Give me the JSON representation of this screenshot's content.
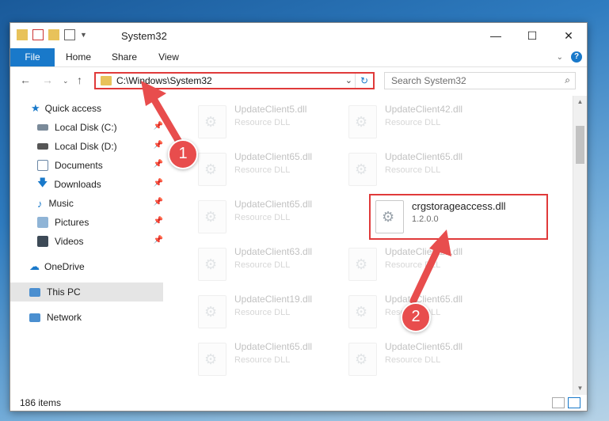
{
  "window": {
    "title": "System32"
  },
  "ribbon": {
    "tabs": [
      "File",
      "Home",
      "Share",
      "View"
    ],
    "help": "?"
  },
  "address": {
    "path": "C:\\Windows\\System32"
  },
  "search": {
    "placeholder": "Search System32"
  },
  "sidebar": {
    "items": [
      {
        "label": "Quick access",
        "icon": "star-icon"
      },
      {
        "label": "Local Disk (C:)",
        "icon": "drive-icon"
      },
      {
        "label": "Local Disk (D:)",
        "icon": "drive-icon"
      },
      {
        "label": "Documents",
        "icon": "documents-icon"
      },
      {
        "label": "Downloads",
        "icon": "download-icon"
      },
      {
        "label": "Music",
        "icon": "music-icon"
      },
      {
        "label": "Pictures",
        "icon": "pictures-icon"
      },
      {
        "label": "Videos",
        "icon": "videos-icon"
      },
      {
        "label": "OneDrive",
        "icon": "cloud-icon"
      },
      {
        "label": "This PC",
        "icon": "computer-icon"
      },
      {
        "label": "Network",
        "icon": "network-icon"
      }
    ]
  },
  "files": [
    {
      "name": "UpdateClient5.dll",
      "type": "Resource DLL"
    },
    {
      "name": "UpdateClient42.dll",
      "type": "Resource DLL"
    },
    {
      "name": "UpdateClient65.dll",
      "type": "Resource DLL"
    },
    {
      "name": "UpdateClient65.dll",
      "type": "Resource DLL"
    },
    {
      "name": "UpdateClient65.dll",
      "type": "Resource DLL"
    },
    {
      "name": "crgstorageaccess.dll",
      "type": "1.2.0.0"
    },
    {
      "name": "UpdateClient63.dll",
      "type": "Resource DLL"
    },
    {
      "name": "UpdateClient21.dll",
      "type": "Resource DLL"
    },
    {
      "name": "UpdateClient19.dll",
      "type": "Resource DLL"
    },
    {
      "name": "UpdateClient65.dll",
      "type": "Resource DLL"
    },
    {
      "name": "UpdateClient65.dll",
      "type": "Resource DLL"
    },
    {
      "name": "UpdateClient65.dll",
      "type": "Resource DLL"
    }
  ],
  "status": {
    "count": "186 items"
  },
  "annotations": {
    "step1": "1",
    "step2": "2"
  },
  "colors": {
    "accent": "#1979ca",
    "highlight": "#e03a3a"
  }
}
